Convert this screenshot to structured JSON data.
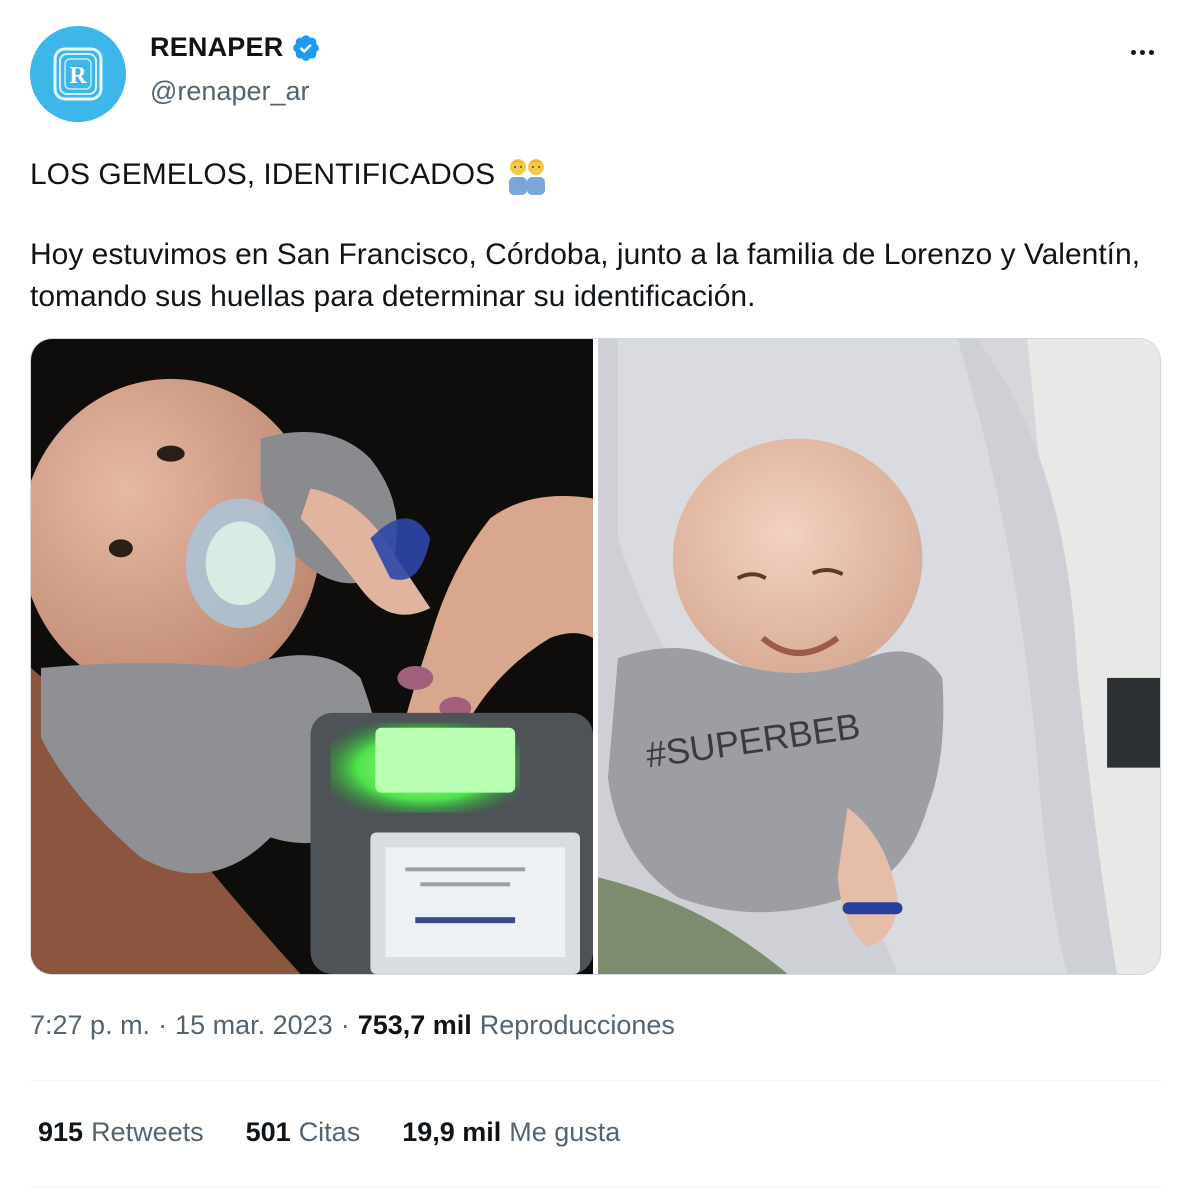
{
  "author": {
    "display_name": "RENAPER",
    "handle": "@renaper_ar",
    "avatar_icon": "renaper-logo-icon",
    "verified_icon": "verified-badge-icon",
    "brand_color": "#3db6ea",
    "verified_color": "#1d9bf0"
  },
  "menu": {
    "icon": "more-options-icon"
  },
  "tweet": {
    "title": "LOS GEMELOS, IDENTIFICADOS",
    "emoji": "twins-emoji-icon",
    "body": "Hoy estuvimos en San Francisco, Córdoba, junto a la familia de Lorenzo y Valentín, tomando sus huellas para determinar su identificación."
  },
  "media": [
    {
      "name": "baby-fingerprint-scan-photo"
    },
    {
      "name": "smiling-baby-photo"
    }
  ],
  "meta": {
    "time": "7:27 p. m.",
    "sep1": "·",
    "date": "15 mar. 2023",
    "sep2": "·",
    "views_count": "753,7 mil",
    "views_label": "Reproducciones"
  },
  "stats": {
    "retweets_count": "915",
    "retweets_label": "Retweets",
    "quotes_count": "501",
    "quotes_label": "Citas",
    "likes_count": "19,9 mil",
    "likes_label": "Me gusta"
  },
  "colors": {
    "text_primary": "#0f1419",
    "text_secondary": "#536471",
    "divider": "#eff3f4"
  }
}
